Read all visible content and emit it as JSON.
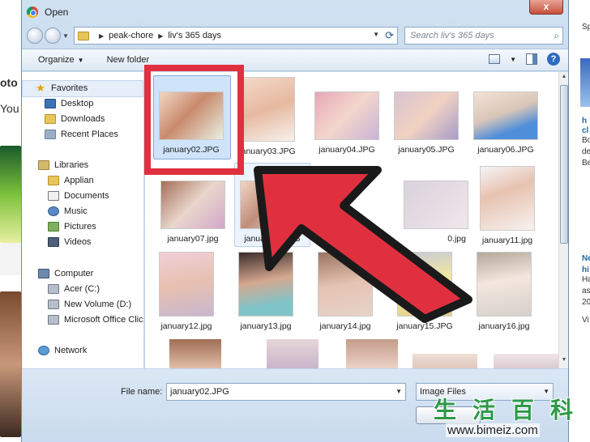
{
  "window": {
    "title": "Open",
    "close_label": "x"
  },
  "address": {
    "crumbs": [
      "peak-chore",
      "liv's 365 days"
    ],
    "search_placeholder": "Search liv's 365 days"
  },
  "toolbar": {
    "organize_label": "Organize",
    "new_folder_label": "New folder"
  },
  "nav": {
    "favorites_label": "Favorites",
    "favorites": [
      "Desktop",
      "Downloads",
      "Recent Places"
    ],
    "libraries_label": "Libraries",
    "libraries": [
      "Applian",
      "Documents",
      "Music",
      "Pictures",
      "Videos"
    ],
    "computer_label": "Computer",
    "drives": [
      "Acer (C:)",
      "New Volume (D:)",
      "Microsoft Office Clic"
    ],
    "network_label": "Network"
  },
  "files": [
    "january02.JPG",
    "january03.JPG",
    "january04.JPG",
    "january05.JPG",
    "january06.JPG",
    "january07.jpg",
    "january08.JPG",
    "0.jpg",
    "january11.jpg",
    "january12.jpg",
    "january13.jpg",
    "january14.jpg",
    "january15.JPG",
    "january16.jpg"
  ],
  "filename": {
    "label": "File name:",
    "value": "january02.JPG"
  },
  "filetype": {
    "value": "Image Files"
  },
  "background": {
    "left_texts": [
      "oto",
      "You"
    ],
    "right_texts": [
      "Sp",
      "Ne",
      "h",
      "cl",
      "Bo",
      "de",
      "Be",
      "Ne",
      "hi",
      "Ha",
      "as",
      "20",
      "Vi"
    ]
  },
  "watermark": {
    "glyphs": [
      "生",
      "活",
      "百",
      "科"
    ],
    "url": "www.bimeiz.com"
  },
  "colors": {
    "highlight_red": "#e03040",
    "selection_blue": "#cfe3fa",
    "watermark_green": "#2c9a47"
  }
}
